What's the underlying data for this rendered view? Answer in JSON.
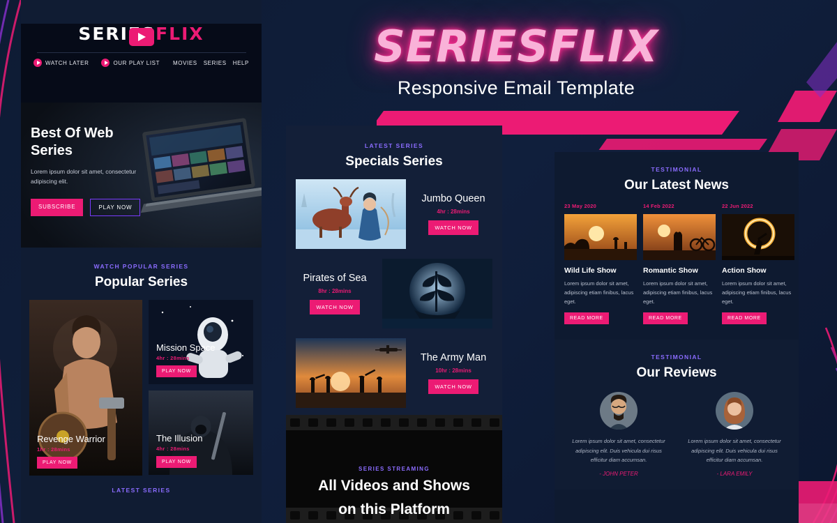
{
  "hero": {
    "logo": "SERIESFLIX",
    "subtitle": "Responsive Email Template"
  },
  "email": {
    "nav": {
      "brand_part1": "SERIES",
      "brand_part2": "FLIX",
      "watch_later": "WATCH LATER",
      "play_list": "OUR PLAY LIST",
      "links": [
        "MOVIES",
        "SERIES",
        "HELP"
      ]
    },
    "hero_card": {
      "title": "Best Of Web Series",
      "text": "Lorem ipsum dolor sit amet, consectetur adipiscing elit.",
      "btn_primary": "SUBSCRIBE",
      "btn_secondary": "PLAY NOW"
    },
    "popular": {
      "kicker": "WATCH POPULAR SERIES",
      "title": "Popular Series",
      "cards": [
        {
          "title": "Revenge Warrior",
          "time": "1hr : 28mins",
          "btn": "PLAY NOW"
        },
        {
          "title": "Mission Space",
          "time": "4hr : 28mins",
          "btn": "PLAY NOW"
        },
        {
          "title": "The Illusion",
          "time": "4hr : 28mins",
          "btn": "PLAY NOW"
        }
      ]
    },
    "bottom_kicker": "LATEST SERIES"
  },
  "specials": {
    "kicker": "LATEST SERIES",
    "title": "Specials Series",
    "items": [
      {
        "title": "Jumbo Queen",
        "time": "4hr : 28mins",
        "btn": "WATCH NOW"
      },
      {
        "title": "Pirates of Sea",
        "time": "8hr : 28mins",
        "btn": "WATCH NOW"
      },
      {
        "title": "The Army Man",
        "time": "10hr : 28mins",
        "btn": "WATCH NOW"
      }
    ],
    "banner": {
      "kicker": "SERIES STREAMING",
      "title_line1": "All Videos and Shows",
      "title_line2": "on this Platform"
    }
  },
  "news": {
    "kicker": "TESTIMONIAL",
    "title": "Our Latest News",
    "cards": [
      {
        "date": "23 May 2020",
        "title": "Wild Life Show",
        "text": "Lorem ipsum dolor sit amet, adipiscing etiam finibus, lacus eget.",
        "btn": "READ MORE"
      },
      {
        "date": "14 Feb 2022",
        "title": "Romantic Show",
        "text": "Lorem ipsum dolor sit amet, adipiscing etiam finibus, lacus eget.",
        "btn": "READ MORE"
      },
      {
        "date": "22 Jun 2022",
        "title": "Action Show",
        "text": "Lorem ipsum dolor sit amet, adipiscing etiam finibus, lacus eget.",
        "btn": "READ MORE"
      }
    ]
  },
  "reviews": {
    "kicker": "TESTIMONIAL",
    "title": "Our Reviews",
    "items": [
      {
        "text": "Lorem ipsum dolor sit amet, consectetur adipiscing elit. Duis vehicula dui risus efficitur diam accumsan.",
        "name": "- JOHN PETER"
      },
      {
        "text": "Lorem ipsum dolor sit amet, consectetur adipiscing elit. Duis vehicula dui risus efficitur diam accumsan.",
        "name": "- LARA EMILY"
      }
    ]
  },
  "colors": {
    "pink": "#ec1b74",
    "purple": "#8b6cff",
    "dark": "#101c33"
  }
}
